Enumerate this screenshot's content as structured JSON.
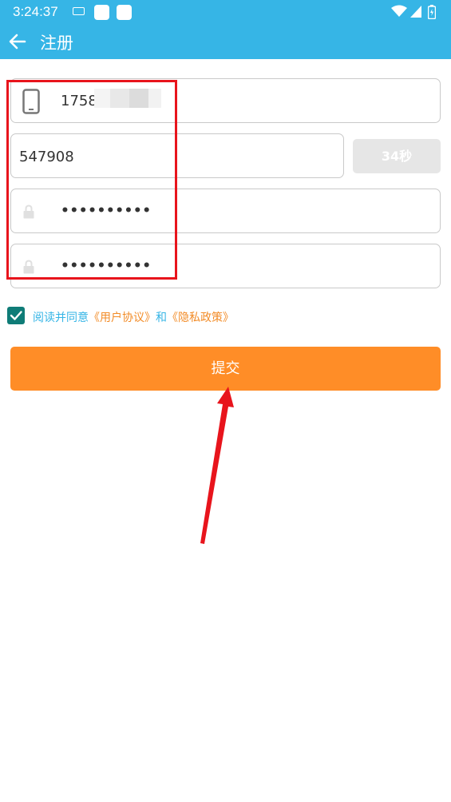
{
  "status_bar": {
    "time": "3:24:37"
  },
  "toolbar": {
    "title": "注册"
  },
  "form": {
    "phone_value": "1758",
    "sms_code_value": "547908",
    "countdown_label": "34秒",
    "password_value": "••••••••••",
    "confirm_password_value": "••••••••••"
  },
  "agreement": {
    "checked": true,
    "prefix": "阅读并同意",
    "user_agreement": "《用户协议》",
    "and": "和",
    "privacy_policy": "《隐私政策》"
  },
  "submit": {
    "label": "提交"
  },
  "colors": {
    "primary": "#36b5e6",
    "accent": "#ff8d27",
    "checkbox": "#0f7c77",
    "annotation": "#e8141c"
  }
}
